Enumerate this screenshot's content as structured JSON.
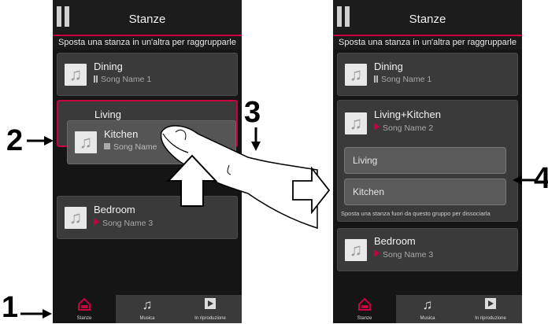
{
  "left": {
    "title": "Stanze",
    "subtitle": "Sposta una stanza in un'altra per raggrupparle",
    "rooms": [
      {
        "name": "Dining",
        "song": "Song Name 1",
        "status": "paused"
      },
      {
        "name": "Living",
        "song": "",
        "status": "selected"
      },
      {
        "name": "Kitchen",
        "song": "Song Name",
        "status": "stopped"
      },
      {
        "name": "Bedroom",
        "song": "Song Name 3",
        "status": "playing"
      }
    ],
    "nav": [
      {
        "label": "Stanze",
        "icon": "house-icon",
        "active": true
      },
      {
        "label": "Musica",
        "icon": "music-note-icon",
        "active": false
      },
      {
        "label": "In riproduzione",
        "icon": "play-icon",
        "active": false
      }
    ]
  },
  "right": {
    "title": "Stanze",
    "subtitle": "Sposta una stanza in un'altra per raggrupparle",
    "rooms": [
      {
        "name": "Dining",
        "song": "Song Name 1",
        "status": "paused"
      },
      {
        "name": "Living+Kitchen",
        "song": "Song Name 2",
        "status": "playing"
      },
      {
        "name": "Bedroom",
        "song": "Song Name 3",
        "status": "playing"
      }
    ],
    "group_members": [
      "Living",
      "Kitchen"
    ],
    "group_hint": "Sposta una stanza fuori da questo gruppo per dissociarla",
    "nav": [
      {
        "label": "Stanze",
        "icon": "house-icon",
        "active": true
      },
      {
        "label": "Musica",
        "icon": "music-note-icon",
        "active": false
      },
      {
        "label": "In riproduzione",
        "icon": "play-icon",
        "active": false
      }
    ]
  },
  "callouts": {
    "one": "1",
    "two": "2",
    "three": "3",
    "four": "4"
  },
  "colors": {
    "accent": "#c8003c",
    "background": "#151515",
    "card": "#3a3a3a"
  }
}
